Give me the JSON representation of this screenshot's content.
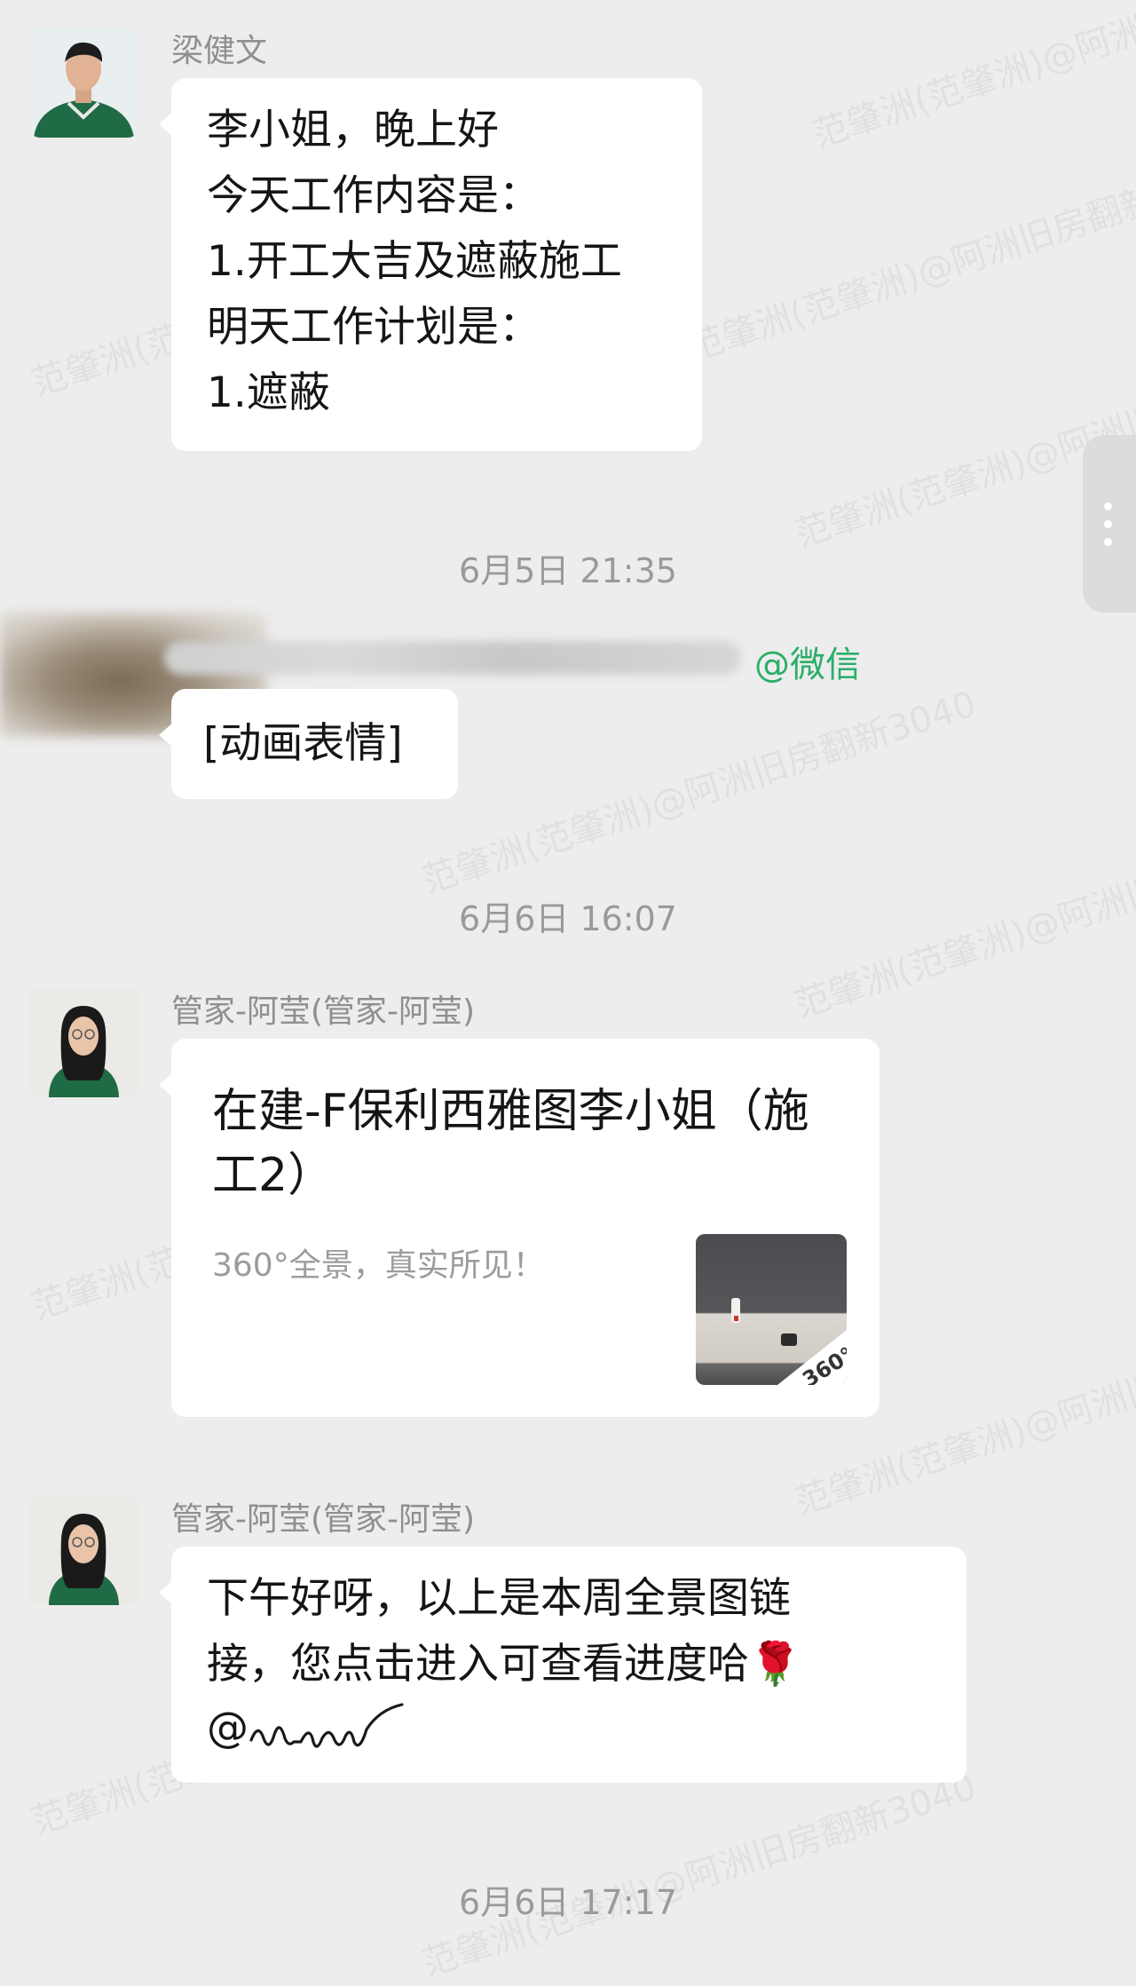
{
  "chat": {
    "messages": [
      {
        "sender": "梁健文",
        "lines": [
          "李小姐，晚上好",
          "今天工作内容是：",
          "1.开工大吉及遮蔽施工",
          "明天工作计划是：",
          "1.遮蔽"
        ]
      }
    ],
    "timestamps": [
      "6月5日 21:35",
      "6月6日 16:07",
      "6月6日 17:17"
    ],
    "blurred_message": {
      "mention": "@微信",
      "text": "[动画表情]"
    },
    "link_card": {
      "sender": "管家-阿莹(管家-阿莹)",
      "title_line1": "在建-F保利西雅图李小姐（施",
      "title_line2": "工2）",
      "description": "360°全景，真实所见！",
      "thumb_badge": "360°"
    },
    "reply": {
      "sender": "管家-阿莹(管家-阿莹)",
      "line1": "下午好呀，以上是本周全景图链",
      "line2": "接，您点击进入可查看进度哈🌹",
      "line3": "@"
    }
  },
  "watermark": {
    "text_a": "范肇洲(范肇洲)@阿洲旧房翻新3040",
    "text_b": "范肇洲(范肇洲)@阿洲旧房翻新3040"
  },
  "colors": {
    "background": "#ededed",
    "bubble": "#ffffff",
    "mention": "#2aae67",
    "timestamp": "#9a9a9a"
  }
}
